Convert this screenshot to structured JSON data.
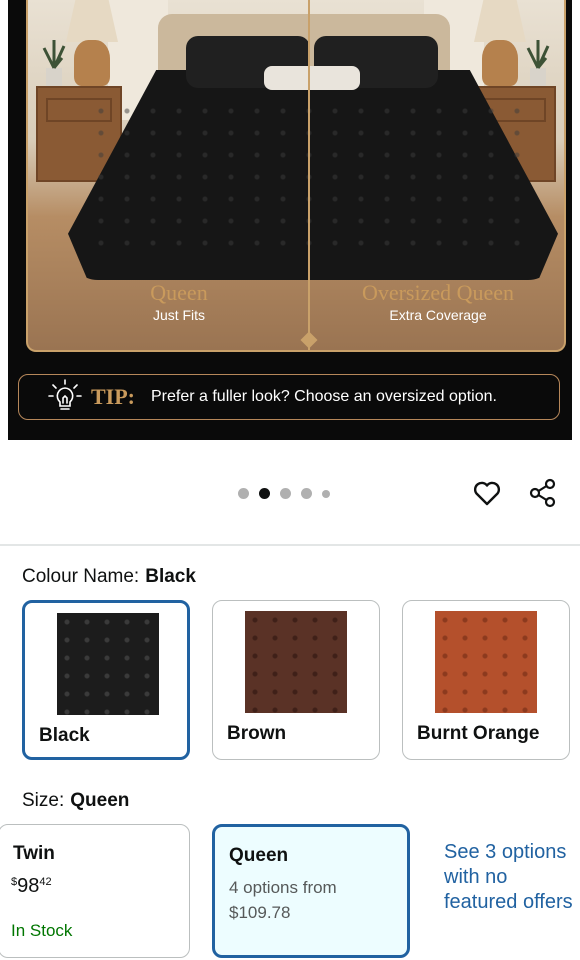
{
  "hero": {
    "left_label_title": "Queen",
    "left_label_sub": "Just Fits",
    "right_label_title": "Oversized Queen",
    "right_label_sub": "Extra Coverage",
    "tip_label": "TIP:",
    "tip_text": "Prefer a fuller look? Choose an oversized option."
  },
  "carousel": {
    "total_dots": 5,
    "active_index": 1
  },
  "colour": {
    "label": "Colour Name:",
    "selected": "Black",
    "options": [
      {
        "name": "Black",
        "color": "#1c1c1c"
      },
      {
        "name": "Brown",
        "color": "#5a3226"
      },
      {
        "name": "Burnt Orange",
        "color": "#b4502c"
      }
    ]
  },
  "size": {
    "label": "Size:",
    "selected": "Queen",
    "twin": {
      "name": "Twin",
      "price_symbol": "$",
      "price_whole": "98",
      "price_fraction": "42",
      "stock": "In Stock"
    },
    "queen": {
      "name": "Queen",
      "options_text": "4 options from",
      "options_price": "$109.78"
    },
    "see_options": "See 3 options with no featured offers"
  },
  "colors": {
    "accent": "#2162a1",
    "selected_bg": "#edfdff",
    "in_stock": "#007600",
    "gold": "#c99a5c"
  }
}
